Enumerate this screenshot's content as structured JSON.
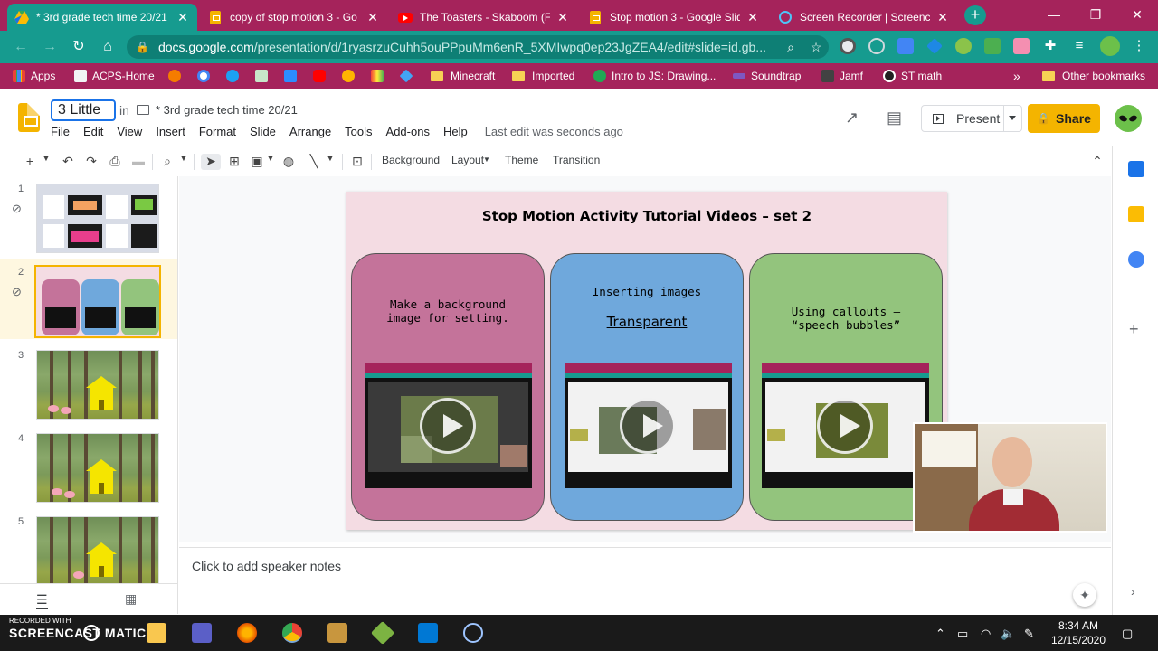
{
  "browser": {
    "tabs": [
      {
        "label": "* 3rd grade tech time 20/21",
        "icon": "google-drive-icon",
        "active": true
      },
      {
        "label": "copy of stop motion 3 - Go",
        "icon": "google-slides-icon",
        "active": false
      },
      {
        "label": "The Toasters - Skaboom (Fu",
        "icon": "youtube-icon",
        "active": false
      },
      {
        "label": "Stop motion 3 - Google Slid",
        "icon": "google-slides-icon",
        "active": false
      },
      {
        "label": "Screen Recorder | Screenca",
        "icon": "screen-recorder-icon",
        "active": false
      }
    ],
    "url_host": "docs.google.com",
    "url_path": "/presentation/d/1ryasrzuCuhh5ouPPpuMm6enR_5XMIwpq0ep23JgZEA4/edit#slide=id.gb...",
    "bookmarks": [
      {
        "label": "Apps"
      },
      {
        "label": "ACPS-Home"
      },
      {
        "label": "Minecraft"
      },
      {
        "label": "Imported"
      },
      {
        "label": "Intro to JS: Drawing..."
      },
      {
        "label": "Soundtrap"
      },
      {
        "label": "Jamf"
      },
      {
        "label": "ST math"
      }
    ],
    "bookmarks_more": "»",
    "other_bookmarks": "Other bookmarks",
    "colors": {
      "tabstrip": "#a5235b",
      "toolbar": "#169b8f"
    }
  },
  "slides": {
    "doc_title_value": "3 Little",
    "in_label": "in",
    "folder_name": "* 3rd grade tech time 20/21",
    "menu": [
      "File",
      "Edit",
      "View",
      "Insert",
      "Format",
      "Slide",
      "Arrange",
      "Tools",
      "Add-ons",
      "Help"
    ],
    "last_edit": "Last edit was seconds ago",
    "present_label": "Present",
    "share_label": "Share",
    "toolbar": {
      "background": "Background",
      "layout": "Layout",
      "theme": "Theme",
      "transition": "Transition"
    },
    "filmstrip_numbers": [
      "1",
      "2",
      "3",
      "4",
      "5"
    ],
    "selected_slide": "2",
    "speaker_notes_placeholder": "Click to add speaker notes"
  },
  "current_slide": {
    "title": "Stop Motion Activity Tutorial Videos – set 2",
    "cards": [
      {
        "line1": "Make a background",
        "line2": "image for setting.",
        "subtitle": "",
        "color": "#c4739a"
      },
      {
        "line1": "Inserting images",
        "line2": "",
        "subtitle": "Transparent",
        "color": "#6fa8dc"
      },
      {
        "line1": "Using callouts –",
        "line2": "“speech bubbles”",
        "subtitle": "",
        "color": "#93c47d"
      }
    ]
  },
  "taskbar": {
    "recorder_line1": "RECORDED WITH",
    "recorder_line2": "SCREENCAST  MATIC",
    "time": "8:34 AM",
    "date": "12/15/2020"
  }
}
